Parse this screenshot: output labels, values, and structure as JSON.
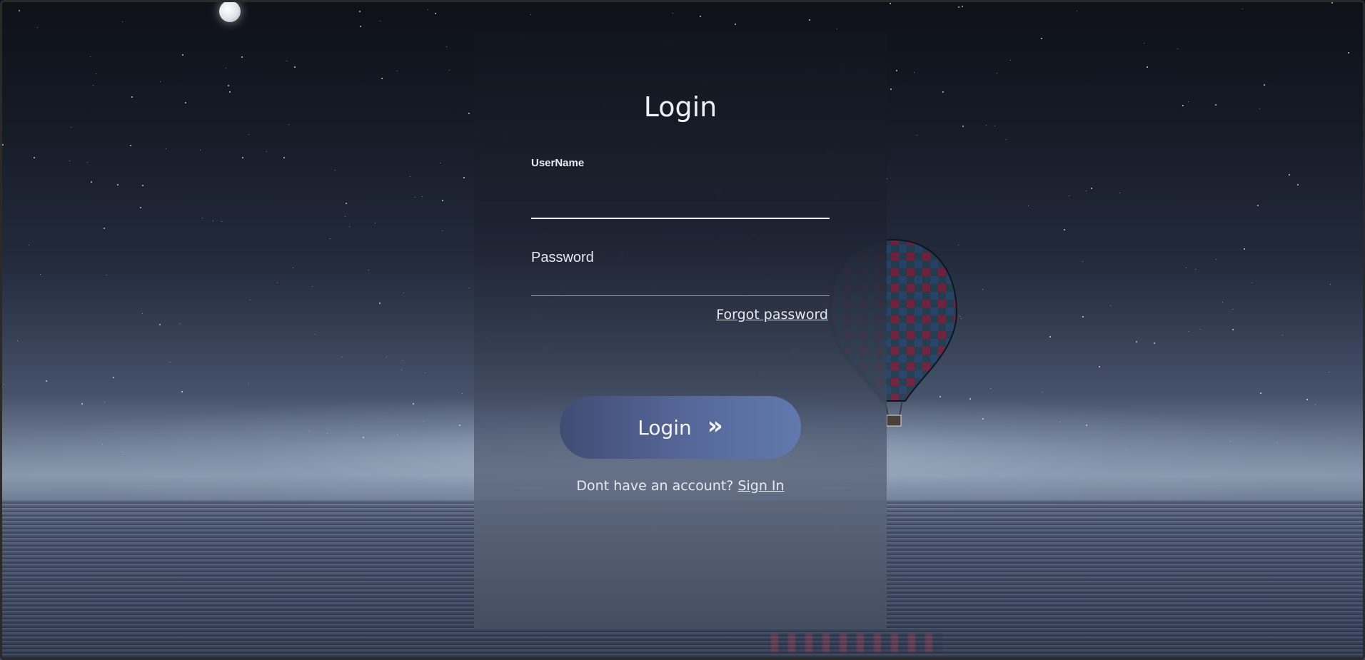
{
  "login_panel": {
    "title": "Login",
    "username_label": "UserName",
    "username_value": "",
    "password_label": "Password",
    "password_value": "",
    "forgot_password": "Forgot password",
    "login_button_label": "Login",
    "login_button_icon": "»",
    "signup_prompt": "Dont have an account?",
    "signup_link": "Sign In"
  },
  "colors": {
    "button_start": "#414c74",
    "button_end": "#6179ad",
    "text": "#eef1f6"
  },
  "icons": {
    "login_button": "double-chevron-right-icon"
  }
}
